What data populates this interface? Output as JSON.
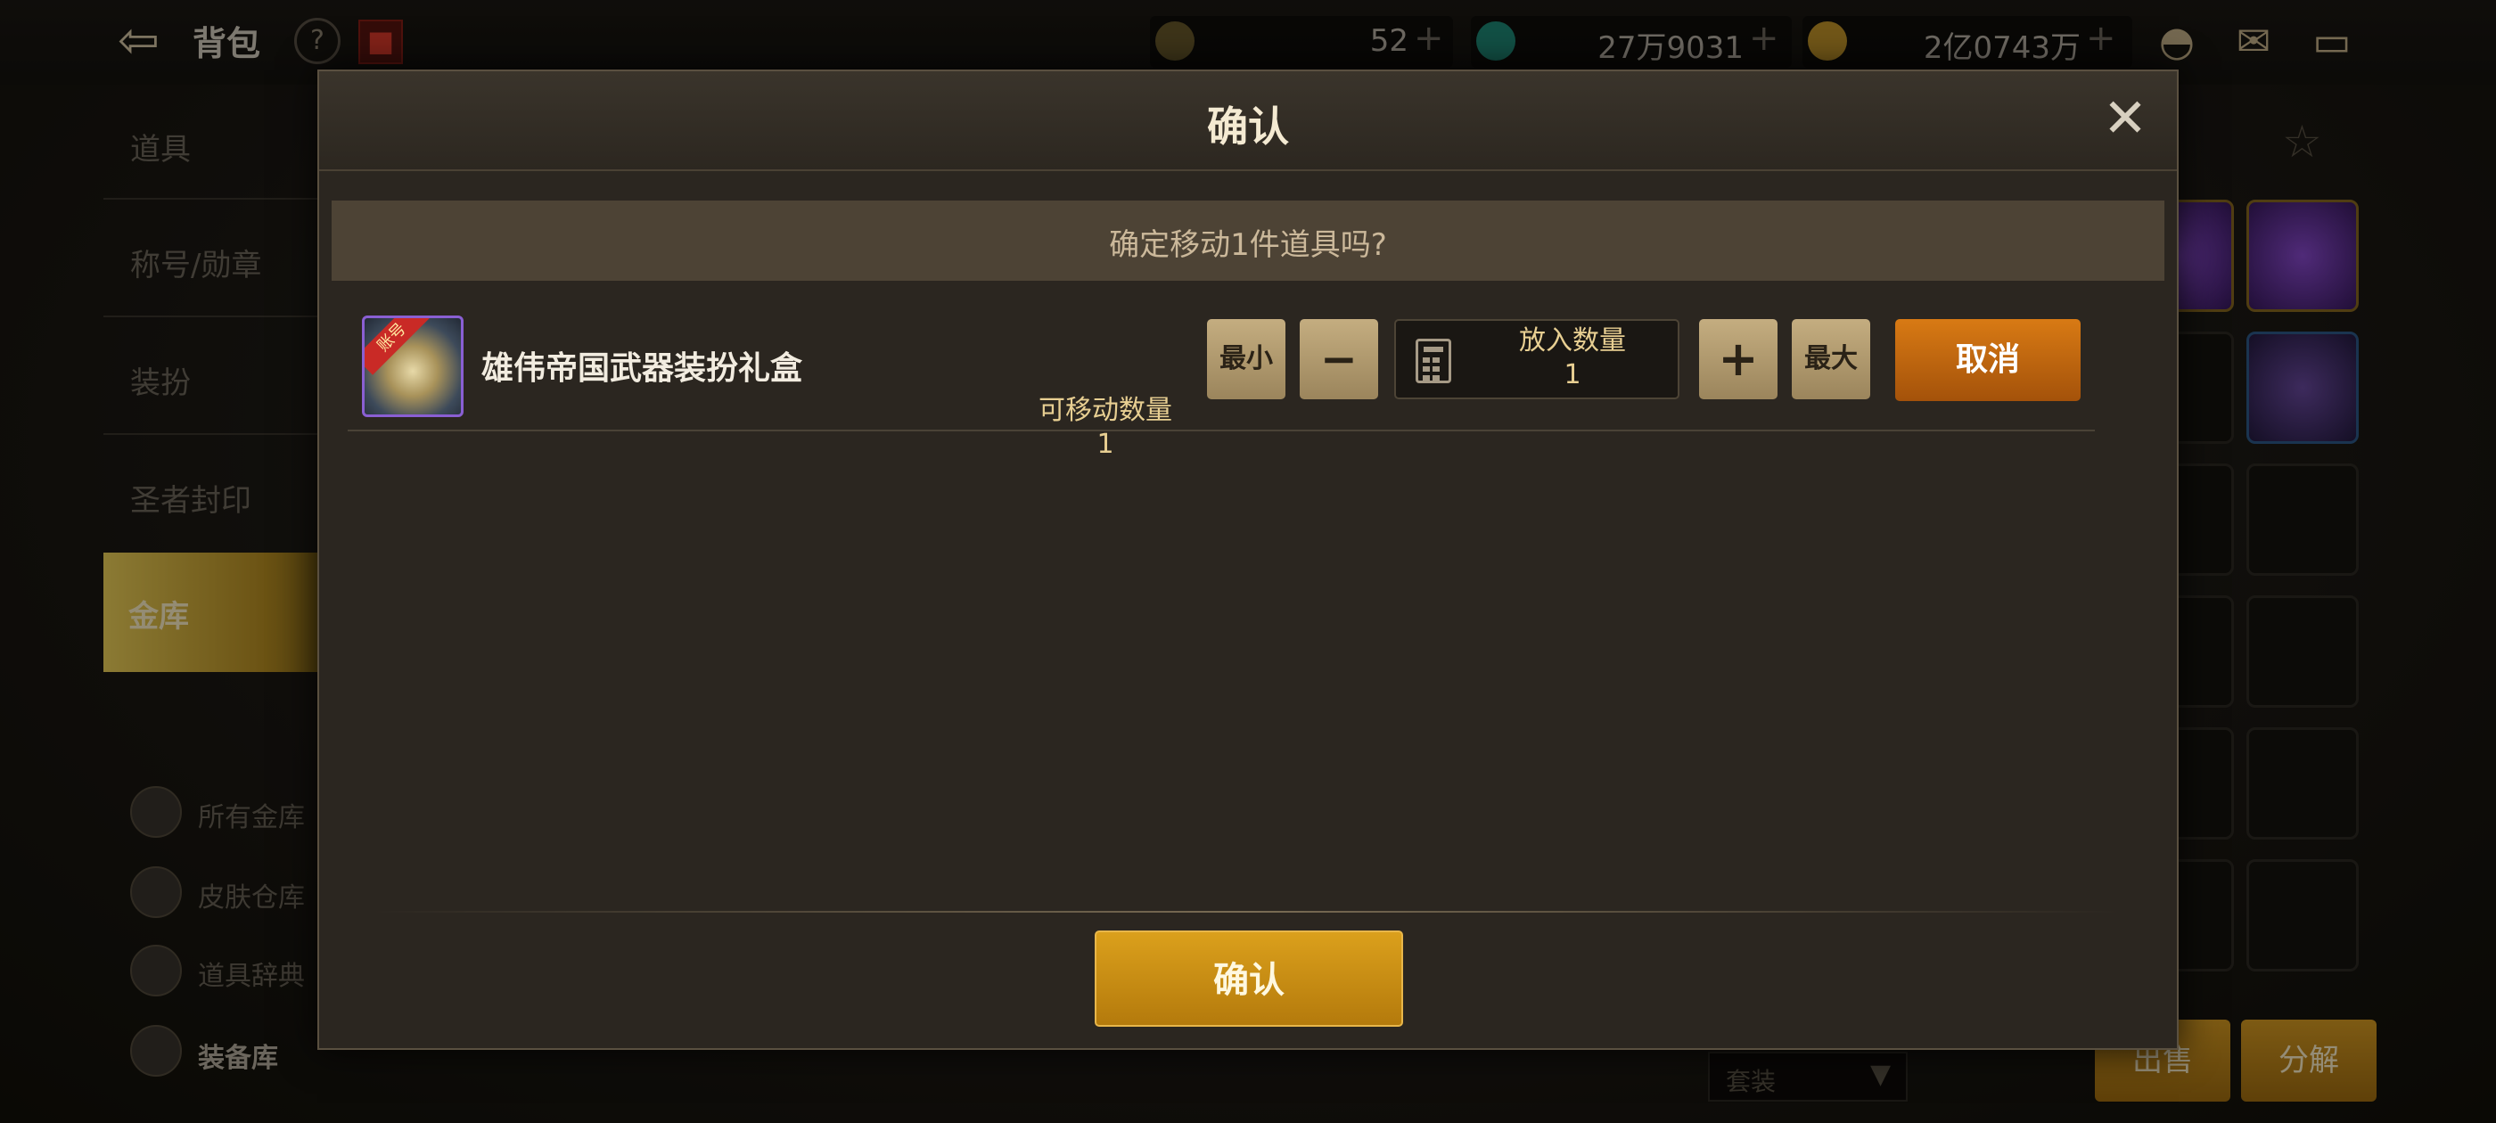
{
  "topbar": {
    "title": "背包",
    "currency1": "52",
    "currency2": "27万9031",
    "currency3": "2亿0743万4429"
  },
  "sidebar": {
    "items": [
      {
        "label": "道具"
      },
      {
        "label": "称号/勋章"
      },
      {
        "label": "装扮"
      },
      {
        "label": "圣者封印"
      },
      {
        "label": "金库"
      }
    ],
    "sub_items": [
      {
        "label": "所有金库"
      },
      {
        "label": "皮肤仓库"
      },
      {
        "label": "道具辞典"
      },
      {
        "label": "装备库"
      }
    ]
  },
  "background": {
    "select_value": "套装",
    "btn_sell": "出售",
    "btn_decompose": "分解"
  },
  "modal": {
    "title": "确认",
    "prompt": "确定移动1件道具吗?",
    "item": {
      "ribbon": "账号",
      "name": "雄伟帝国武器装扮礼盒",
      "movable_label": "可移动数量",
      "movable_value": "1",
      "put_label": "放入数量",
      "put_value": "1"
    },
    "btn_min": "最小",
    "btn_minus": "−",
    "btn_plus": "+",
    "btn_max": "最大",
    "btn_cancel": "取消",
    "btn_confirm": "确认",
    "close_glyph": "✕"
  },
  "colors": {
    "accent_gold": "#b47a0c",
    "cancel_orange": "#d87a14",
    "item_border_purple": "#8a5fd3"
  }
}
